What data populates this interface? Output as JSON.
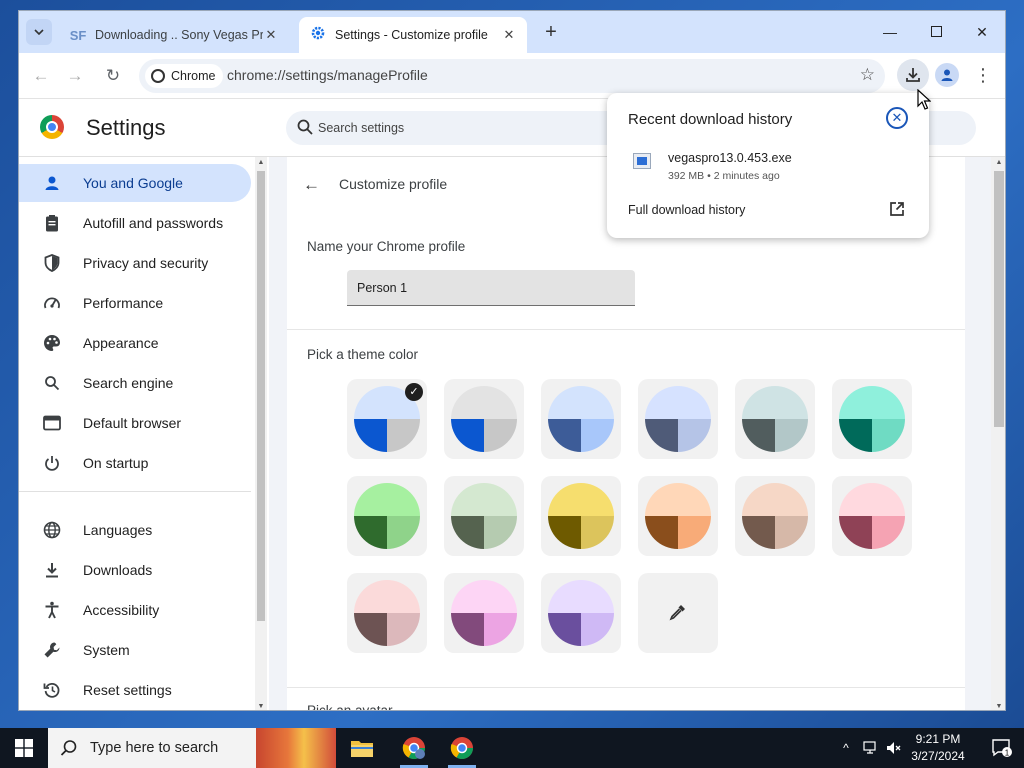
{
  "browser": {
    "tabs": [
      {
        "favicon": "SF",
        "title": "Downloading .. Sony Vegas Pro",
        "active": false
      },
      {
        "favicon": "gear-icon",
        "title": "Settings - Customize profile",
        "active": true
      }
    ],
    "chip_label": "Chrome",
    "url": "chrome://settings/manageProfile"
  },
  "settings": {
    "title": "Settings",
    "search_placeholder": "Search settings",
    "sidebar": [
      {
        "label": "You and Google",
        "icon": "person-icon",
        "active": true
      },
      {
        "label": "Autofill and passwords",
        "icon": "clipboard-icon"
      },
      {
        "label": "Privacy and security",
        "icon": "shield-icon"
      },
      {
        "label": "Performance",
        "icon": "gauge-icon"
      },
      {
        "label": "Appearance",
        "icon": "palette-icon"
      },
      {
        "label": "Search engine",
        "icon": "search-icon"
      },
      {
        "label": "Default browser",
        "icon": "browser-icon"
      },
      {
        "label": "On startup",
        "icon": "power-icon"
      },
      {
        "label": "Languages",
        "icon": "globe-icon"
      },
      {
        "label": "Downloads",
        "icon": "download-icon"
      },
      {
        "label": "Accessibility",
        "icon": "accessibility-icon"
      },
      {
        "label": "System",
        "icon": "wrench-icon"
      },
      {
        "label": "Reset settings",
        "icon": "reset-icon"
      }
    ]
  },
  "customize_profile": {
    "title": "Customize profile",
    "name_label": "Name your Chrome profile",
    "name_value": "Person 1",
    "theme_label": "Pick a theme color",
    "avatar_label": "Pick an avatar",
    "themes": [
      {
        "top": "#d3e3fd",
        "left": "#0b57d0",
        "right": "#c7c7c7",
        "selected": true
      },
      {
        "top": "#e3e3e3",
        "left": "#0b57d0",
        "right": "#c7c7c7"
      },
      {
        "top": "#d3e3fd",
        "left": "#3d5c98",
        "right": "#a8c7fa"
      },
      {
        "top": "#d6e2ff",
        "left": "#4f5b78",
        "right": "#b5c4e7"
      },
      {
        "top": "#cfe3e4",
        "left": "#515d5e",
        "right": "#b2c7c8"
      },
      {
        "top": "#8ff0dc",
        "left": "#006a5a",
        "right": "#6fdbc3"
      },
      {
        "top": "#a6f0a0",
        "left": "#2f6b2d",
        "right": "#8fd38a"
      },
      {
        "top": "#d4e8d0",
        "left": "#55634f",
        "right": "#b5cbb0"
      },
      {
        "top": "#f6de6e",
        "left": "#6e5a00",
        "right": "#dcc45c"
      },
      {
        "top": "#ffd7b8",
        "left": "#8a4e1c",
        "right": "#f8ab78"
      },
      {
        "top": "#f6d7c6",
        "left": "#735a4d",
        "right": "#d6b8a8"
      },
      {
        "top": "#ffd9df",
        "left": "#8f4256",
        "right": "#f5a3b3"
      },
      {
        "top": "#fbdada",
        "left": "#6d5353",
        "right": "#dcb8bb"
      },
      {
        "top": "#fdd5f5",
        "left": "#824a7c",
        "right": "#eca4e3"
      },
      {
        "top": "#e8dcff",
        "left": "#6a4f9e",
        "right": "#cfb9f5"
      }
    ]
  },
  "download_bubble": {
    "title": "Recent download history",
    "file_name": "vegaspro13.0.453.exe",
    "file_meta": "392 MB • 2 minutes ago",
    "full_history": "Full download history"
  },
  "taskbar": {
    "search_placeholder": "Type here to search",
    "time": "9:21 PM",
    "date": "3/27/2024",
    "notification_count": "1"
  }
}
